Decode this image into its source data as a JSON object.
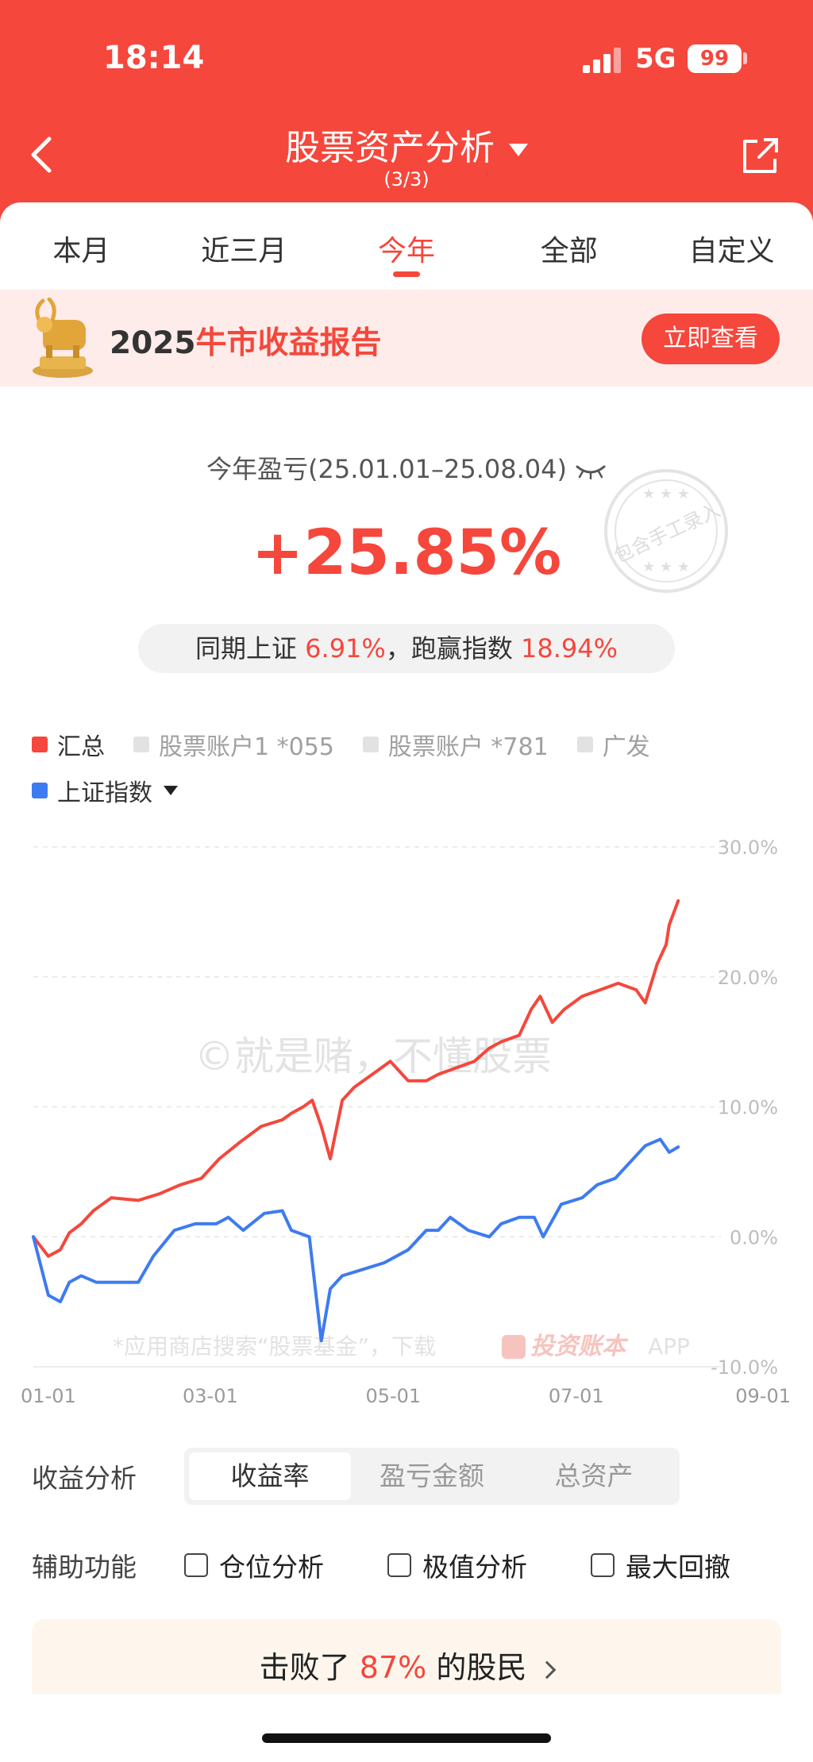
{
  "status_bar": {
    "time": "18:14",
    "network": "5G",
    "battery": "99"
  },
  "header": {
    "title": "股票资产分析",
    "subtitle": "(3/3)"
  },
  "tabs": [
    {
      "label": "本月",
      "active": false
    },
    {
      "label": "近三月",
      "active": false
    },
    {
      "label": "今年",
      "active": true
    },
    {
      "label": "全部",
      "active": false
    },
    {
      "label": "自定义",
      "active": false
    }
  ],
  "banner": {
    "year": "2025",
    "text": "牛市收益报告",
    "button": "立即查看"
  },
  "summary": {
    "label": "今年盈亏(25.01.01–25.08.04)",
    "value": "+25.85%",
    "compare_prefix": "同期上证",
    "compare_sh": "6.91%",
    "compare_mid": "，跑赢指数",
    "compare_beat": "18.94%",
    "stamp_text": "包含手工录入"
  },
  "legend": {
    "items": [
      {
        "label": "汇总",
        "color": "#f5473c",
        "active": true
      },
      {
        "label": "股票账户1 *055",
        "color": "#e2e2e2",
        "active": false
      },
      {
        "label": "股票账户  *781",
        "color": "#e2e2e2",
        "active": false
      },
      {
        "label": "广发",
        "color": "#e2e2e2",
        "active": false
      }
    ],
    "benchmark": {
      "label": "上证指数",
      "color": "#3d7bf0"
    }
  },
  "chart_data": {
    "type": "line",
    "y_ticks": [
      "30.0%",
      "20.0%",
      "10.0%",
      "0.0%",
      "-10.0%"
    ],
    "x_ticks": [
      "01-01",
      "03-01",
      "05-01",
      "07-01",
      "09-01"
    ],
    "ylim": [
      -10,
      30
    ],
    "x_range": [
      "2025-01-01",
      "2025-09-01"
    ],
    "watermark": "©就是赌，不懂股票",
    "footer_note": "*应用商店搜索“股票基金”，下载",
    "footer_brand": "投资账本",
    "footer_app": "APP",
    "series": [
      {
        "name": "汇总",
        "color": "#f5473c",
        "points": [
          [
            "2025-01-01",
            0.0
          ],
          [
            "2025-01-06",
            -1.5
          ],
          [
            "2025-01-10",
            -1.0
          ],
          [
            "2025-01-13",
            0.3
          ],
          [
            "2025-01-17",
            1.0
          ],
          [
            "2025-01-21",
            2.0
          ],
          [
            "2025-01-27",
            3.0
          ],
          [
            "2025-02-05",
            2.8
          ],
          [
            "2025-02-12",
            3.3
          ],
          [
            "2025-02-19",
            4.0
          ],
          [
            "2025-02-26",
            4.5
          ],
          [
            "2025-03-04",
            6.0
          ],
          [
            "2025-03-11",
            7.3
          ],
          [
            "2025-03-18",
            8.5
          ],
          [
            "2025-03-25",
            9.0
          ],
          [
            "2025-03-28",
            9.5
          ],
          [
            "2025-04-01",
            10.0
          ],
          [
            "2025-04-04",
            10.5
          ],
          [
            "2025-04-07",
            8.5
          ],
          [
            "2025-04-10",
            6.0
          ],
          [
            "2025-04-14",
            10.5
          ],
          [
            "2025-04-18",
            11.5
          ],
          [
            "2025-04-24",
            12.5
          ],
          [
            "2025-04-30",
            13.5
          ],
          [
            "2025-05-06",
            12.0
          ],
          [
            "2025-05-12",
            12.0
          ],
          [
            "2025-05-16",
            12.5
          ],
          [
            "2025-05-22",
            13.0
          ],
          [
            "2025-05-28",
            13.5
          ],
          [
            "2025-06-02",
            14.5
          ],
          [
            "2025-06-06",
            15.0
          ],
          [
            "2025-06-12",
            15.5
          ],
          [
            "2025-06-16",
            17.5
          ],
          [
            "2025-06-19",
            18.5
          ],
          [
            "2025-06-23",
            16.5
          ],
          [
            "2025-06-27",
            17.5
          ],
          [
            "2025-07-03",
            18.5
          ],
          [
            "2025-07-09",
            19.0
          ],
          [
            "2025-07-15",
            19.5
          ],
          [
            "2025-07-21",
            19.0
          ],
          [
            "2025-07-24",
            18.0
          ],
          [
            "2025-07-28",
            21.0
          ],
          [
            "2025-07-31",
            22.5
          ],
          [
            "2025-08-01",
            24.0
          ],
          [
            "2025-08-04",
            25.85
          ]
        ]
      },
      {
        "name": "上证指数",
        "color": "#3d7bf0",
        "points": [
          [
            "2025-01-01",
            0.0
          ],
          [
            "2025-01-06",
            -4.5
          ],
          [
            "2025-01-10",
            -5.0
          ],
          [
            "2025-01-13",
            -3.5
          ],
          [
            "2025-01-17",
            -3.0
          ],
          [
            "2025-01-22",
            -3.5
          ],
          [
            "2025-02-05",
            -3.5
          ],
          [
            "2025-02-10",
            -1.5
          ],
          [
            "2025-02-17",
            0.5
          ],
          [
            "2025-02-24",
            1.0
          ],
          [
            "2025-03-03",
            1.0
          ],
          [
            "2025-03-07",
            1.5
          ],
          [
            "2025-03-12",
            0.5
          ],
          [
            "2025-03-19",
            1.8
          ],
          [
            "2025-03-25",
            2.0
          ],
          [
            "2025-03-28",
            0.5
          ],
          [
            "2025-04-03",
            0.0
          ],
          [
            "2025-04-07",
            -8.0
          ],
          [
            "2025-04-10",
            -4.0
          ],
          [
            "2025-04-14",
            -3.0
          ],
          [
            "2025-04-21",
            -2.5
          ],
          [
            "2025-04-28",
            -2.0
          ],
          [
            "2025-05-06",
            -1.0
          ],
          [
            "2025-05-12",
            0.5
          ],
          [
            "2025-05-16",
            0.5
          ],
          [
            "2025-05-20",
            1.5
          ],
          [
            "2025-05-26",
            0.5
          ],
          [
            "2025-06-02",
            0.0
          ],
          [
            "2025-06-06",
            1.0
          ],
          [
            "2025-06-12",
            1.5
          ],
          [
            "2025-06-17",
            1.5
          ],
          [
            "2025-06-20",
            0.0
          ],
          [
            "2025-06-26",
            2.5
          ],
          [
            "2025-07-03",
            3.0
          ],
          [
            "2025-07-08",
            4.0
          ],
          [
            "2025-07-14",
            4.5
          ],
          [
            "2025-07-18",
            5.5
          ],
          [
            "2025-07-24",
            7.0
          ],
          [
            "2025-07-29",
            7.5
          ],
          [
            "2025-08-01",
            6.5
          ],
          [
            "2025-08-04",
            6.91
          ]
        ]
      }
    ]
  },
  "analysis": {
    "label": "收益分析",
    "options": [
      {
        "label": "收益率",
        "active": true
      },
      {
        "label": "盈亏金额",
        "active": false
      },
      {
        "label": "总资产",
        "active": false
      }
    ]
  },
  "aux": {
    "label": "辅助功能",
    "options": [
      "仓位分析",
      "极值分析",
      "最大回撤"
    ]
  },
  "beat": {
    "prefix": "击败了",
    "percent": "87%",
    "suffix": "的股民"
  }
}
